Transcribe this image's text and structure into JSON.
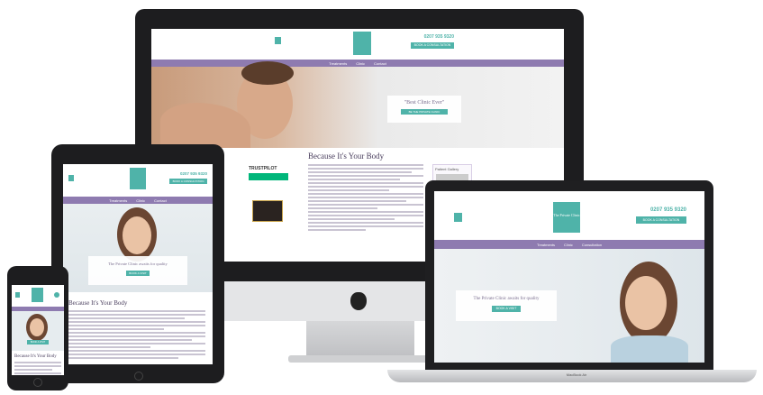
{
  "imac": {
    "phone": "0207 935 9320",
    "book_button": "BOOK A CONSULTATION",
    "nav": [
      "Treatments",
      "Clinic",
      "Contact"
    ],
    "hero_quote": "\"Best Clinic Ever\"",
    "hero_button": "BE THE PRIVATE CLINIC",
    "trustpilot": "TRUSTPILOT",
    "section_heading": "Because It's Your Body",
    "sidebar_label": "Patient Gallery"
  },
  "laptop": {
    "phone": "0207 935 9320",
    "book_button": "BOOK A CONSULTATION",
    "nav": [
      "Treatments",
      "Clinic",
      "Consultation"
    ],
    "logo_text": "The Private Clinic",
    "hero_tagline": "The Private Clinic awaits for quality",
    "hero_button": "BOOK A VISIT",
    "base_label": "MacBook Air"
  },
  "tablet": {
    "phone": "0207 935 9320",
    "book_button": "BOOK A CONSULTATION",
    "nav": [
      "Treatments",
      "Clinic",
      "Contact"
    ],
    "hero_tagline": "The Private Clinic awaits for quality",
    "hero_button": "BOOK A VISIT",
    "section_heading": "Because It's Your Body"
  },
  "phone": {
    "hero_button": "BOOK A VISIT",
    "section_heading": "Because It's Your Body"
  },
  "colors": {
    "teal": "#4fb3a9",
    "purple": "#8e7bb0",
    "device_black": "#1d1d1f",
    "aluminium": "#e4e5e7"
  }
}
